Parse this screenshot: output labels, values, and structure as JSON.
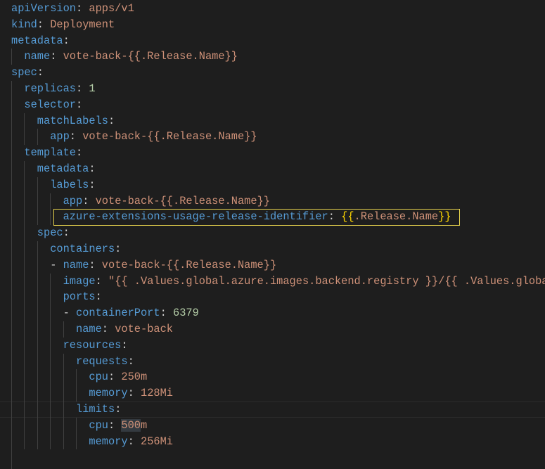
{
  "editor": {
    "language": "yaml",
    "colors": {
      "background": "#1e1e1e",
      "key": "#569cd6",
      "string": "#ce9178",
      "number": "#b5cea8",
      "punctuation": "#d4d4d4",
      "bracket": "#ffd700",
      "highlight_box": "#e8d44d"
    },
    "active_line": 25,
    "highlighted_line": 13,
    "lines": [
      {
        "indent": 0,
        "key": "apiVersion",
        "value": "apps/v1",
        "type": "string"
      },
      {
        "indent": 0,
        "key": "kind",
        "value": "Deployment",
        "type": "string"
      },
      {
        "indent": 0,
        "key": "metadata",
        "value": "",
        "type": "none"
      },
      {
        "indent": 1,
        "key": "name",
        "value": "vote-back-{{.Release.Name}}",
        "type": "string"
      },
      {
        "indent": 0,
        "key": "spec",
        "value": "",
        "type": "none"
      },
      {
        "indent": 1,
        "key": "replicas",
        "value": "1",
        "type": "number"
      },
      {
        "indent": 1,
        "key": "selector",
        "value": "",
        "type": "none"
      },
      {
        "indent": 2,
        "key": "matchLabels",
        "value": "",
        "type": "none"
      },
      {
        "indent": 3,
        "key": "app",
        "value": "vote-back-{{.Release.Name}}",
        "type": "string"
      },
      {
        "indent": 1,
        "key": "template",
        "value": "",
        "type": "none"
      },
      {
        "indent": 2,
        "key": "metadata",
        "value": "",
        "type": "none"
      },
      {
        "indent": 3,
        "key": "labels",
        "value": "",
        "type": "none"
      },
      {
        "indent": 4,
        "key": "app",
        "value": "vote-back-{{.Release.Name}}",
        "type": "string"
      },
      {
        "indent": 4,
        "key": "azure-extensions-usage-release-identifier",
        "value": "{{.Release.Name}}",
        "type": "template"
      },
      {
        "indent": 2,
        "key": "spec",
        "value": "",
        "type": "none"
      },
      {
        "indent": 3,
        "key": "containers",
        "value": "",
        "type": "none"
      },
      {
        "indent": 3,
        "dash": true,
        "key": "name",
        "value": "vote-back-{{.Release.Name}}",
        "type": "string"
      },
      {
        "indent": 4,
        "key": "image",
        "value": "\"{{ .Values.global.azure.images.backend.registry }}/{{ .Values.globa",
        "type": "string"
      },
      {
        "indent": 4,
        "key": "ports",
        "value": "",
        "type": "none"
      },
      {
        "indent": 4,
        "dash": true,
        "key": "containerPort",
        "value": "6379",
        "type": "number"
      },
      {
        "indent": 5,
        "key": "name",
        "value": "vote-back",
        "type": "string"
      },
      {
        "indent": 4,
        "key": "resources",
        "value": "",
        "type": "none"
      },
      {
        "indent": 5,
        "key": "requests",
        "value": "",
        "type": "none"
      },
      {
        "indent": 6,
        "key": "cpu",
        "value": "250m",
        "type": "string"
      },
      {
        "indent": 6,
        "key": "memory",
        "value": "128Mi",
        "type": "string"
      },
      {
        "indent": 5,
        "key": "limits",
        "value": "",
        "type": "none"
      },
      {
        "indent": 6,
        "key": "cpu",
        "value": "500m",
        "type": "string",
        "selected": true
      },
      {
        "indent": 6,
        "key": "memory",
        "value": "256Mi",
        "type": "string"
      },
      {
        "indent": 1,
        "key": "",
        "value": "",
        "type": "none"
      },
      {
        "indent": 1,
        "key": "",
        "value": "",
        "type": "none"
      }
    ]
  }
}
